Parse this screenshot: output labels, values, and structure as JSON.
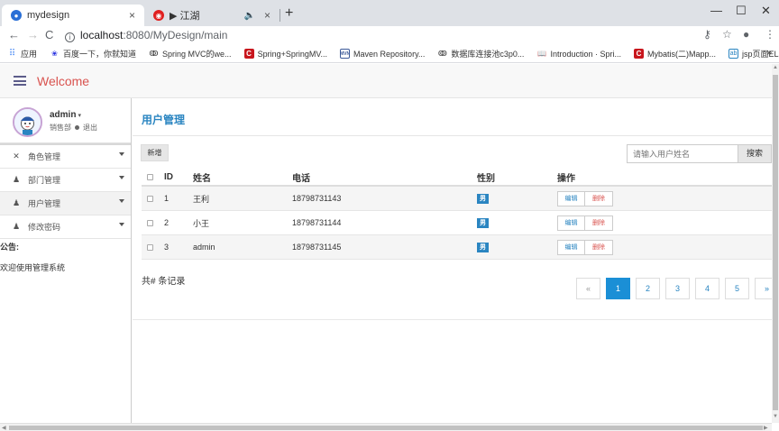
{
  "browser": {
    "tabs": [
      {
        "title": "mydesign",
        "close": "×",
        "favicon": "chrome-app-icon"
      },
      {
        "title": "▶ 江湖",
        "close": "×",
        "mute": "🔈",
        "favicon": "netease-music-icon"
      }
    ],
    "new_tab": "+",
    "window": {
      "minimize": "—",
      "maximize": "☐",
      "close": "✕"
    },
    "nav": {
      "back": "←",
      "forward": "→",
      "reload": "C"
    },
    "url_host": "localhost",
    "url_path": ":8080/MyDesign/main",
    "addr_icons": {
      "key": "⚷",
      "star": "☆",
      "profile": "●",
      "menu": "⋮"
    },
    "bookmarks": [
      {
        "label": "应用",
        "icon": "apps-icon"
      },
      {
        "label": "百度一下，你就知道",
        "icon": "baidu-icon"
      },
      {
        "label": "Spring MVC的we...",
        "icon": "csdn-icon"
      },
      {
        "label": "Spring+SpringMV...",
        "icon": "red-c-icon"
      },
      {
        "label": "Maven Repository...",
        "icon": "mvn-icon"
      },
      {
        "label": "数据库连接池c3p0...",
        "icon": "csdn-icon"
      },
      {
        "label": "Introduction · Spri...",
        "icon": "book-icon"
      },
      {
        "label": "Mybatis(二)Mapp...",
        "icon": "red-c-icon"
      },
      {
        "label": "jsp页面EL表达式$(...",
        "icon": "ab-icon"
      }
    ],
    "bookmarks_more": "»"
  },
  "app": {
    "brand": "Welcome",
    "user": {
      "name": "admin",
      "caret": "▾",
      "dept": "销售部",
      "logout": "退出"
    },
    "menu": [
      {
        "label": "角色管理",
        "icon": "✕",
        "icon_name": "tools-icon"
      },
      {
        "label": "部门管理",
        "icon": "♟",
        "icon_name": "user-icon"
      },
      {
        "label": "用户管理",
        "icon": "♟",
        "icon_name": "user-icon"
      },
      {
        "label": "修改密码",
        "icon": "♟",
        "icon_name": "user-icon"
      }
    ],
    "notice_title": "公告:",
    "notice_text": "欢迎使用管理系统"
  },
  "main": {
    "title": "用户管理",
    "add_label": "新增",
    "search_placeholder": "请输入用户姓名",
    "search_label": "搜索",
    "columns": {
      "id": "ID",
      "name": "姓名",
      "phone": "电话",
      "gender": "性别",
      "ops": "操作"
    },
    "rows": [
      {
        "id": "1",
        "name": "王利",
        "phone": "18798731143",
        "gender": "男"
      },
      {
        "id": "2",
        "name": "小王",
        "phone": "18798731144",
        "gender": "男"
      },
      {
        "id": "3",
        "name": "admin",
        "phone": "18798731145",
        "gender": "男"
      }
    ],
    "edit_label": "编辑",
    "delete_label": "删除",
    "total": "共# 条记录",
    "pager": {
      "prev": "«",
      "pages": [
        "1",
        "2",
        "3",
        "4",
        "5"
      ],
      "current": "1",
      "next": "»"
    }
  },
  "colors": {
    "accent": "#2a85c1",
    "brand": "#d9534f",
    "active_page": "#1b8fd6"
  }
}
